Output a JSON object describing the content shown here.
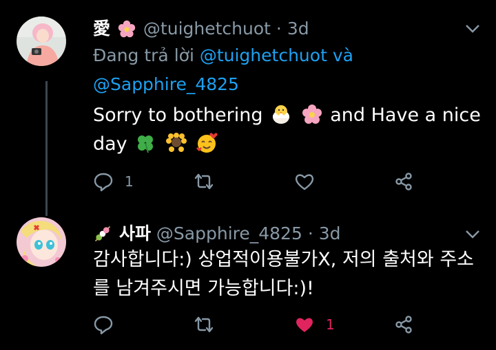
{
  "tweet1": {
    "display_name": "愛",
    "handle": "@tuighetchuot",
    "separator": "·",
    "time": "3d",
    "replying_prefix": "Đang trả lời",
    "replying_user1": "@tuighetchuot",
    "replying_and": "và",
    "replying_user2": "@Sapphire_4825",
    "text_part1": "Sorry to bothering",
    "text_part2": "and Have a nice",
    "text_part3": "day",
    "reply_count": "1",
    "retweet_count": "",
    "like_count": ""
  },
  "tweet2": {
    "display_name": "사파",
    "handle": "@Sapphire_4825",
    "separator": "·",
    "time": "3d",
    "text_line1": "감사합니다:) 상업적이용불가X, 저의 출처와 주소",
    "text_line2": "를 남겨주시면 가능합니다:)!",
    "reply_count": "",
    "retweet_count": "",
    "like_count": "1",
    "liked": true
  },
  "colors": {
    "background": "#000000",
    "secondary_text": "#8899a6",
    "link": "#1da1f2",
    "like": "#e0245e"
  },
  "icons": [
    "cherry-blossom-icon",
    "chick-icon",
    "clover-icon",
    "sunflower-icon",
    "smiling-hearts-icon",
    "dango-icon",
    "reply-icon",
    "retweet-icon",
    "like-icon",
    "share-icon",
    "chevron-down-icon"
  ]
}
